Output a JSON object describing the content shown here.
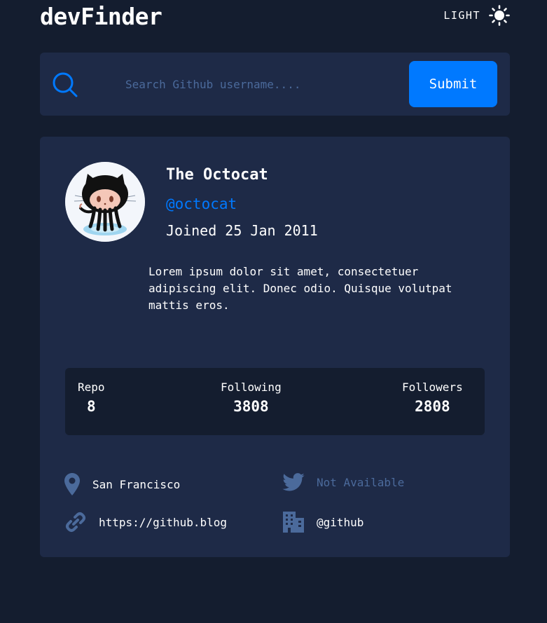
{
  "header": {
    "logo": "devFinder",
    "theme_label": "LIGHT"
  },
  "search": {
    "placeholder": "Search Github username....",
    "value": "",
    "submit_label": "Submit"
  },
  "profile": {
    "name": "The Octocat",
    "login": "@octocat",
    "joined": "Joined 25 Jan 2011",
    "bio": "Lorem ipsum dolor sit amet, consectetuer adipiscing elit. Donec odio. Quisque volutpat mattis eros.",
    "stats": {
      "repo_label": "Repo",
      "repo_value": "8",
      "following_label": "Following",
      "following_value": "3808",
      "followers_label": "Followers",
      "followers_value": "2808"
    },
    "location": "San Francisco",
    "twitter": "Not Available",
    "blog": "https://github.blog",
    "company": "@github"
  },
  "icons": {
    "theme": "sun-icon",
    "search": "search-icon",
    "location": "location-pin-icon",
    "twitter": "twitter-icon",
    "blog": "link-icon",
    "company": "building-icon"
  },
  "colors": {
    "background": "#141d2f",
    "card": "#1e2a47",
    "accent": "#0079ff",
    "muted": "#4b6a9b",
    "text": "#ffffff"
  }
}
